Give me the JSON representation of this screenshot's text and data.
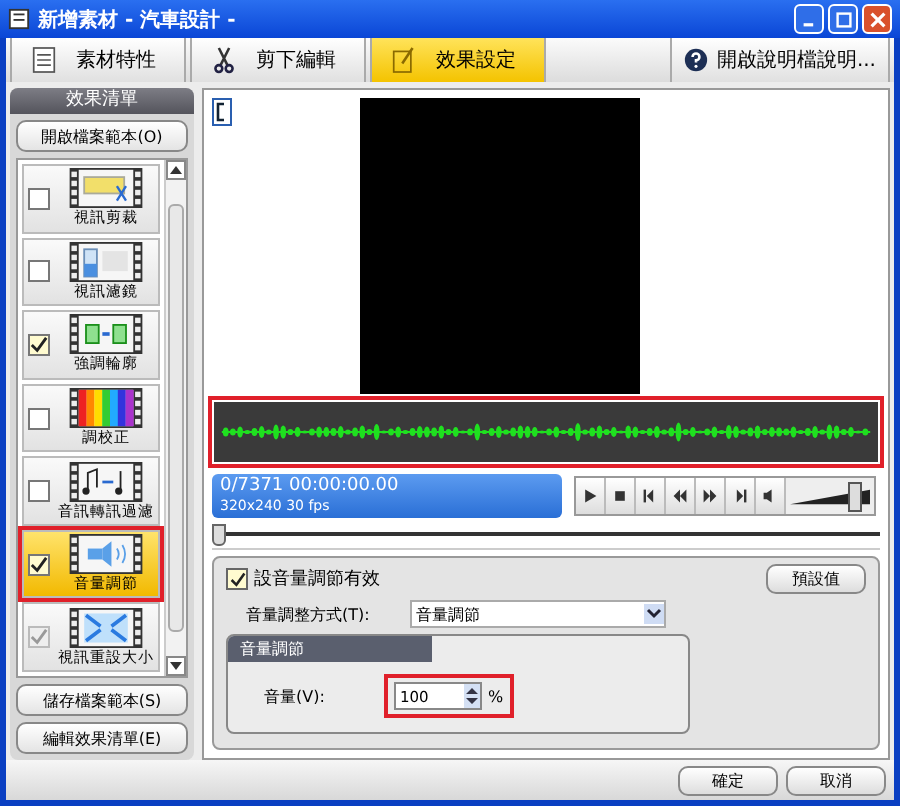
{
  "window": {
    "title": "新增素材 - 汽車設計 -"
  },
  "tabs": [
    {
      "label": "素材特性",
      "selected": false
    },
    {
      "label": "剪下編輯",
      "selected": false
    },
    {
      "label": "效果設定",
      "selected": true
    }
  ],
  "help_button": "開啟說明檔說明...",
  "effects_panel": {
    "title": "效果清單",
    "open_button": "開啟檔案範本(O)",
    "items": [
      {
        "label": "視訊剪裁",
        "checked": false,
        "selected": false,
        "disabled": false
      },
      {
        "label": "視訊濾鏡",
        "checked": false,
        "selected": false,
        "disabled": false
      },
      {
        "label": "強調輪廓",
        "checked": true,
        "selected": false,
        "disabled": false
      },
      {
        "label": "調校正",
        "checked": false,
        "selected": false,
        "disabled": false
      },
      {
        "label": "音訊轉訊過濾",
        "checked": false,
        "selected": false,
        "disabled": false
      },
      {
        "label": "音量調節",
        "checked": true,
        "selected": true,
        "disabled": false
      },
      {
        "label": "視訊重設大小",
        "checked": true,
        "selected": false,
        "disabled": true
      }
    ],
    "buttons": [
      "儲存檔案範本(S)",
      "編輯效果清單(E)"
    ]
  },
  "player": {
    "position": "0/7371  00:00:00.00",
    "format": "320x240 30 fps",
    "volume": {
      "level": 0.8
    },
    "seek": {
      "level": 0.0
    }
  },
  "settings": {
    "enable_label": "設音量調節有效",
    "enabled": true,
    "default_button": "預設值",
    "method_label": "音量調整方式(T):",
    "method_value": "音量調節",
    "group_title": "音量調節",
    "volume_label": "音量(V):",
    "volume_value": "100",
    "unit": "%"
  },
  "footer_buttons": [
    "確定",
    "取消"
  ]
}
